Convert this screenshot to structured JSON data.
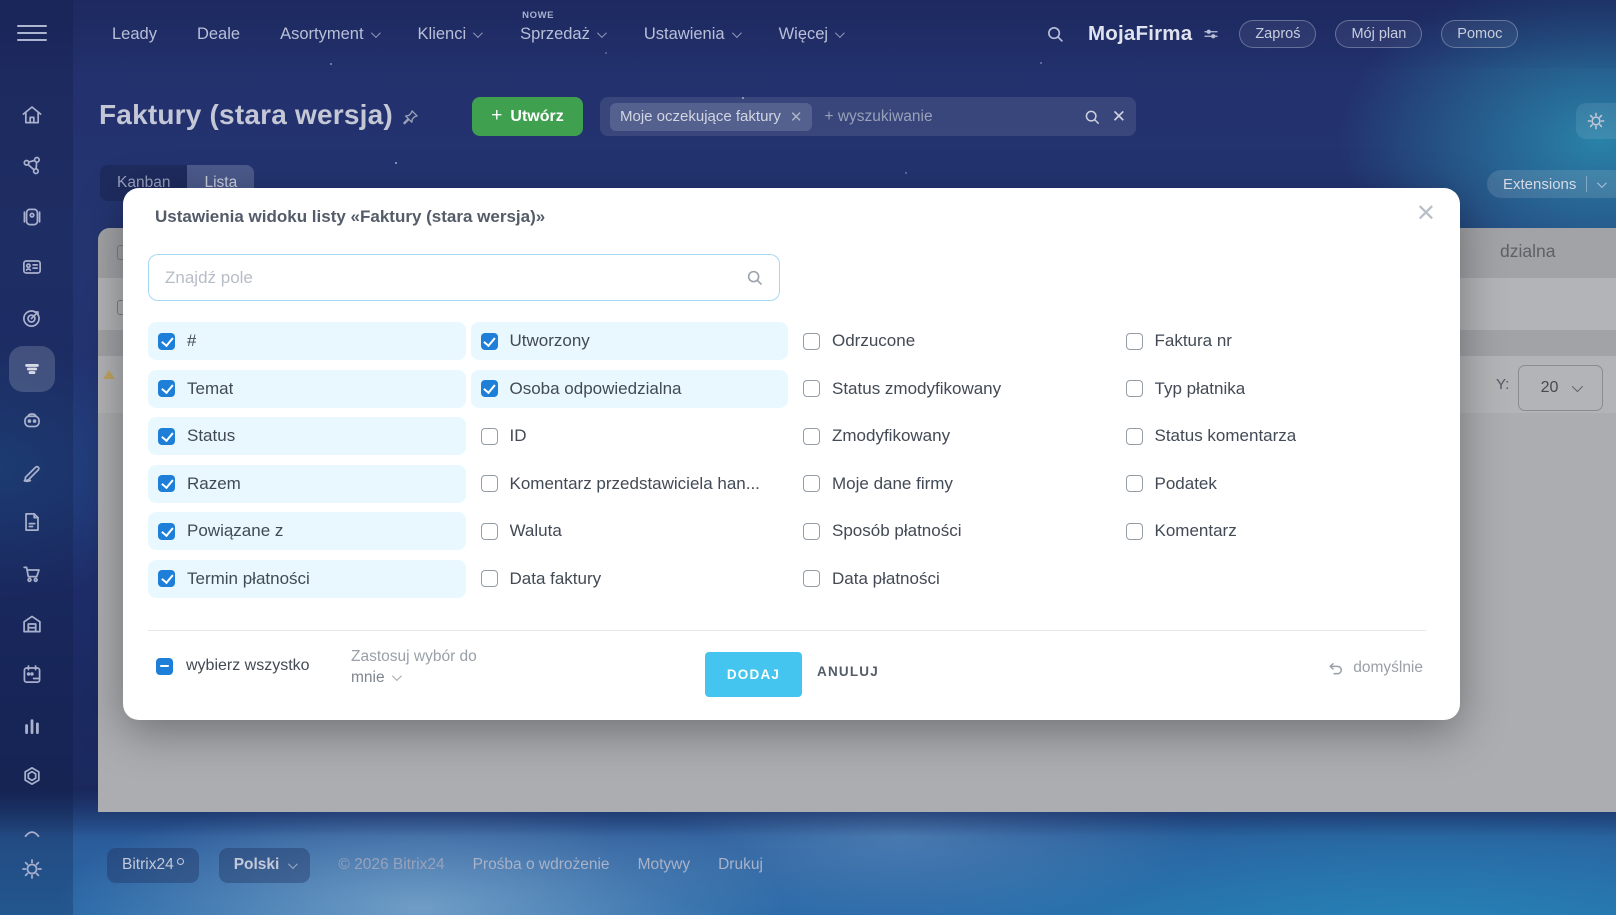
{
  "colors": {
    "checkbox_blue": "#1e7fd8",
    "checked_row_bg": "#e8f8fe",
    "add_button_blue": "#44c5ef",
    "create_button_green": "#3fa150",
    "nav_background": "#223067",
    "teal_glow": "#2ec4d8"
  },
  "topnav": {
    "menu": [
      {
        "label": "Leady",
        "badge": ""
      },
      {
        "label": "Deale",
        "badge": ""
      },
      {
        "label": "Asortyment",
        "badge": ""
      },
      {
        "label": "Klienci",
        "badge": ""
      },
      {
        "label": "Sprzedaż",
        "badge": "NOWE"
      },
      {
        "label": "Ustawienia",
        "badge": ""
      },
      {
        "label": "Więcej",
        "badge": ""
      }
    ],
    "brand": "MojaFirma",
    "buttons": [
      {
        "label": "Zaproś"
      },
      {
        "label": "Mój plan"
      },
      {
        "label": "Pomoc"
      }
    ]
  },
  "page": {
    "title": "Faktury (stara wersja)",
    "create_label": "Utwórz",
    "filter_chip": "Moje oczekujące faktury",
    "filter_placeholder": "+ wyszukiwanie",
    "tabs": [
      {
        "label": "Kanban",
        "active": false
      },
      {
        "label": "Lista",
        "active": true
      }
    ],
    "extensions_label": "Extensions"
  },
  "background_list": {
    "header_fragment": "dzialna",
    "page_size_fragment": "Y:",
    "page_size_value": "20"
  },
  "modal": {
    "title": "Ustawienia widoku listy «Faktury (stara wersja)»",
    "search_placeholder": "Znajdź pole",
    "columns": [
      {
        "items": [
          {
            "label": "#",
            "checked": true
          },
          {
            "label": "Temat",
            "checked": true
          },
          {
            "label": "Status",
            "checked": true
          },
          {
            "label": "Razem",
            "checked": true
          },
          {
            "label": "Powiązane z",
            "checked": true
          },
          {
            "label": "Termin płatności",
            "checked": true
          }
        ]
      },
      {
        "items": [
          {
            "label": "Utworzony",
            "checked": true
          },
          {
            "label": "Osoba odpowiedzialna",
            "checked": true
          },
          {
            "label": "ID",
            "checked": false
          },
          {
            "label": "Komentarz przedstawiciela han...",
            "checked": false
          },
          {
            "label": "Waluta",
            "checked": false
          },
          {
            "label": "Data faktury",
            "checked": false
          }
        ]
      },
      {
        "items": [
          {
            "label": "Odrzucone",
            "checked": false
          },
          {
            "label": "Status zmodyfikowany",
            "checked": false
          },
          {
            "label": "Zmodyfikowany",
            "checked": false
          },
          {
            "label": "Moje dane firmy",
            "checked": false
          },
          {
            "label": "Sposób płatności",
            "checked": false
          },
          {
            "label": "Data płatności",
            "checked": false
          }
        ]
      },
      {
        "items": [
          {
            "label": "Faktura nr",
            "checked": false
          },
          {
            "label": "Typ płatnika",
            "checked": false
          },
          {
            "label": "Status komentarza",
            "checked": false
          },
          {
            "label": "Podatek",
            "checked": false
          },
          {
            "label": "Komentarz",
            "checked": false
          }
        ]
      }
    ],
    "footer": {
      "select_all_label": "wybierz wszystko",
      "apply_label_line1": "Zastosuj wybór do",
      "apply_label_line2": "mnie",
      "add_label": "DODAJ",
      "cancel_label": "ANULUJ",
      "default_label": "domyślnie"
    }
  },
  "sidebar": {
    "items": [
      {
        "icon": "home-icon",
        "active": false
      },
      {
        "icon": "network-icon",
        "active": false
      },
      {
        "icon": "video-icon",
        "active": false
      },
      {
        "icon": "contact-card-icon",
        "active": false
      },
      {
        "icon": "target-icon",
        "active": false
      },
      {
        "icon": "invoices-filter-icon",
        "active": true
      },
      {
        "icon": "robot-icon",
        "active": false
      },
      {
        "icon": "pen-icon",
        "active": false
      },
      {
        "icon": "document-icon",
        "active": false
      },
      {
        "icon": "cart-icon",
        "active": false
      },
      {
        "icon": "warehouse-icon",
        "active": false
      },
      {
        "icon": "calendar-icon",
        "active": false
      },
      {
        "icon": "chart-icon",
        "active": false
      },
      {
        "icon": "hexagon-icon",
        "active": false
      },
      {
        "icon": "arc-icon",
        "active": false
      },
      {
        "icon": "gear-icon",
        "active": false
      }
    ]
  },
  "footer": {
    "brand": "Bitrix24",
    "language": "Polski",
    "copyright": "© 2026 Bitrix24",
    "links": [
      {
        "label": "Prośba o wdrożenie"
      },
      {
        "label": "Motywy"
      },
      {
        "label": "Drukuj"
      }
    ]
  }
}
